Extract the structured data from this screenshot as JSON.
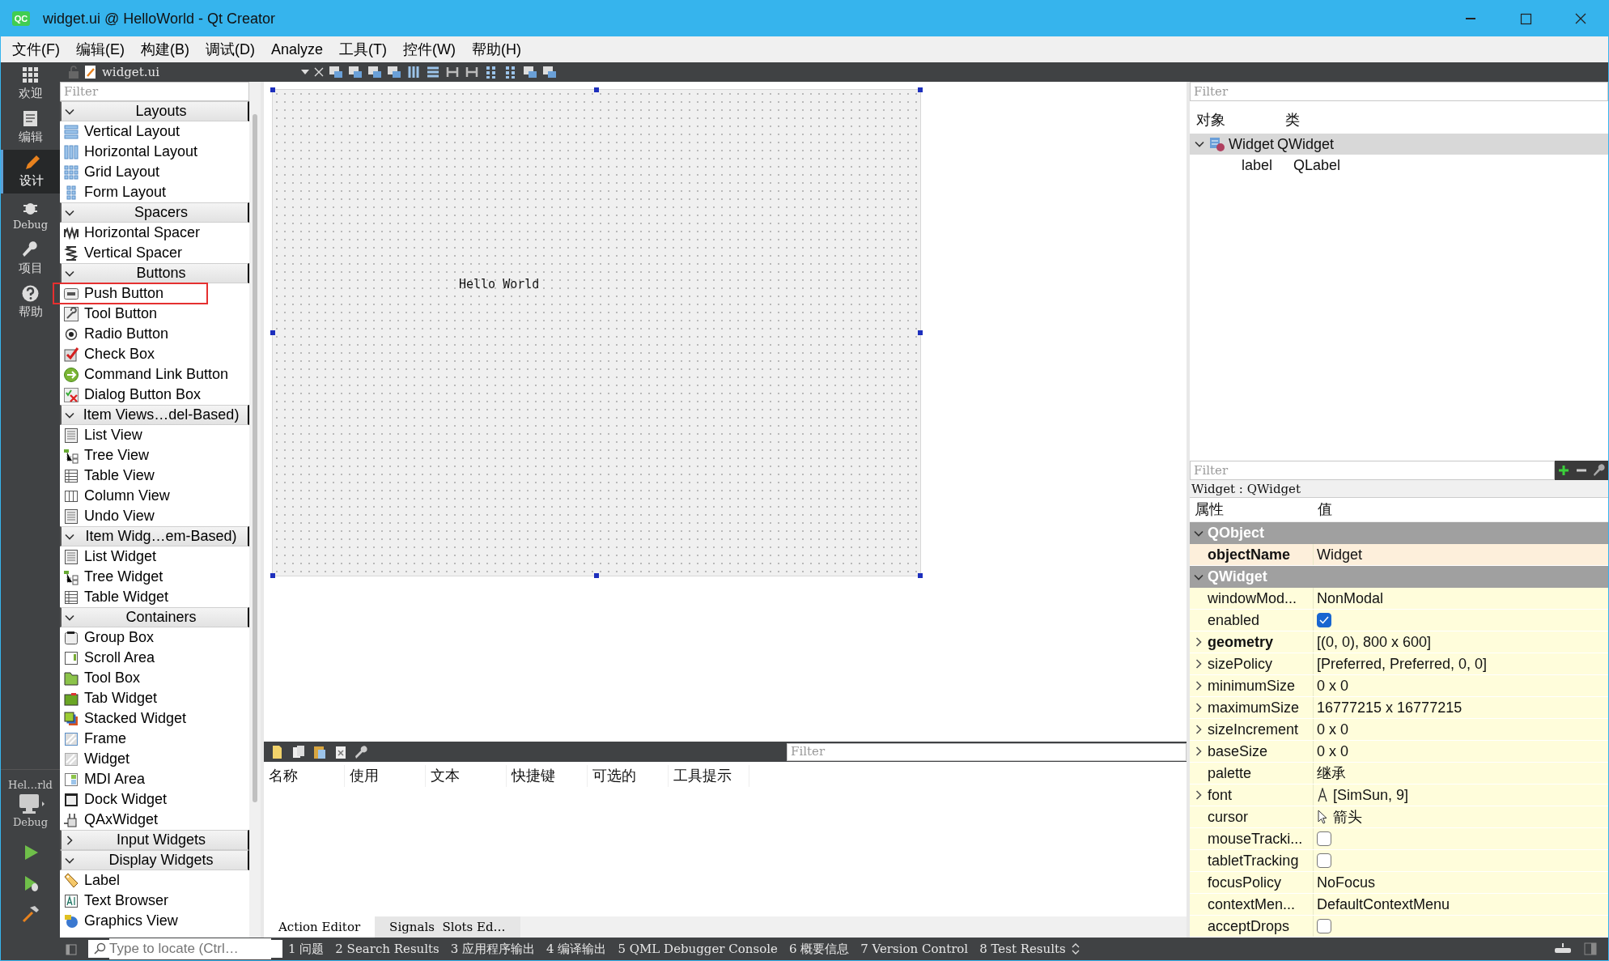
{
  "window": {
    "logo_text": "QC",
    "title": "widget.ui @ HelloWorld - Qt Creator"
  },
  "menu": [
    "文件(F)",
    "编辑(E)",
    "构建(B)",
    "调试(D)",
    "Analyze",
    "工具(T)",
    "控件(W)",
    "帮助(H)"
  ],
  "mode_bar": {
    "items": [
      {
        "label": "欢迎",
        "selected": false
      },
      {
        "label": "编辑",
        "selected": false
      },
      {
        "label": "设计",
        "selected": true
      },
      {
        "label": "Debug",
        "selected": false
      },
      {
        "label": "项目",
        "selected": false
      },
      {
        "label": "帮助",
        "selected": false
      }
    ],
    "target": {
      "project": "Hel…rld",
      "config": "Debug"
    }
  },
  "editor_toolbar": {
    "file": "widget.ui"
  },
  "widget_box": {
    "placeholder": "Filter",
    "categories": [
      {
        "name": "Layouts",
        "expanded": true,
        "items": [
          {
            "label": "Vertical Layout",
            "highlighted": false
          },
          {
            "label": "Horizontal Layout",
            "highlighted": false
          },
          {
            "label": "Grid Layout",
            "highlighted": false
          },
          {
            "label": "Form Layout",
            "highlighted": false
          }
        ]
      },
      {
        "name": "Spacers",
        "expanded": true,
        "items": [
          {
            "label": "Horizontal Spacer",
            "highlighted": false
          },
          {
            "label": "Vertical Spacer",
            "highlighted": false
          }
        ]
      },
      {
        "name": "Buttons",
        "expanded": true,
        "items": [
          {
            "label": "Push Button",
            "highlighted": true
          },
          {
            "label": "Tool Button",
            "highlighted": false
          },
          {
            "label": "Radio Button",
            "highlighted": false
          },
          {
            "label": "Check Box",
            "highlighted": false
          },
          {
            "label": "Command Link Button",
            "highlighted": false
          },
          {
            "label": "Dialog Button Box",
            "highlighted": false
          }
        ]
      },
      {
        "name": "Item Views…del-Based)",
        "expanded": true,
        "items": [
          {
            "label": "List View",
            "highlighted": false
          },
          {
            "label": "Tree View",
            "highlighted": false
          },
          {
            "label": "Table View",
            "highlighted": false
          },
          {
            "label": "Column View",
            "highlighted": false
          },
          {
            "label": "Undo View",
            "highlighted": false
          }
        ]
      },
      {
        "name": "Item Widg…em-Based)",
        "expanded": true,
        "items": [
          {
            "label": "List Widget",
            "highlighted": false
          },
          {
            "label": "Tree Widget",
            "highlighted": false
          },
          {
            "label": "Table Widget",
            "highlighted": false
          }
        ]
      },
      {
        "name": "Containers",
        "expanded": true,
        "items": [
          {
            "label": "Group Box",
            "highlighted": false
          },
          {
            "label": "Scroll Area",
            "highlighted": false
          },
          {
            "label": "Tool Box",
            "highlighted": false
          },
          {
            "label": "Tab Widget",
            "highlighted": false
          },
          {
            "label": "Stacked Widget",
            "highlighted": false
          },
          {
            "label": "Frame",
            "highlighted": false
          },
          {
            "label": "Widget",
            "highlighted": false
          },
          {
            "label": "MDI Area",
            "highlighted": false
          },
          {
            "label": "Dock Widget",
            "highlighted": false
          },
          {
            "label": "QAxWidget",
            "highlighted": false
          }
        ]
      },
      {
        "name": "Input Widgets",
        "expanded": false
      },
      {
        "name": "Display Widgets",
        "expanded": true,
        "items": [
          {
            "label": "Label",
            "highlighted": false
          },
          {
            "label": "Text Browser",
            "highlighted": false
          },
          {
            "label": "Graphics View",
            "highlighted": false
          }
        ]
      }
    ]
  },
  "form": {
    "label_text": "Hello World"
  },
  "action_editor": {
    "placeholder": "Filter",
    "columns": [
      "名称",
      "使用",
      "文本",
      "快捷键",
      "可选的",
      "工具提示"
    ],
    "tabs": [
      {
        "label": "Action Editor",
        "selected": true
      },
      {
        "label": "Signals  Slots Ed…",
        "selected": false
      }
    ]
  },
  "object_inspector": {
    "placeholder": "Filter",
    "columns": [
      "对象",
      "类"
    ],
    "tree": [
      {
        "object": "Widget",
        "class": "QWidget",
        "expanded": true,
        "selected": true,
        "children": [
          {
            "object": "label",
            "class": "QLabel",
            "selected": false
          }
        ]
      }
    ]
  },
  "property_editor": {
    "placeholder": "Filter",
    "title": "Widget : QWidget",
    "columns": [
      "属性",
      "值"
    ],
    "groups": [
      {
        "name": "QObject",
        "expanded": true,
        "properties": [
          {
            "name": "objectName",
            "kind": "text",
            "value": "Widget",
            "modified": true,
            "expandable": false
          }
        ]
      },
      {
        "name": "QWidget",
        "expanded": true,
        "properties": [
          {
            "name": "windowMod...",
            "kind": "text",
            "value": "NonModal",
            "modified": false,
            "expandable": false
          },
          {
            "name": "enabled",
            "kind": "checkbox",
            "checked": true,
            "modified": false,
            "expandable": false
          },
          {
            "name": "geometry",
            "kind": "text",
            "value": "[(0, 0), 800 x 600]",
            "modified": true,
            "expandable": true
          },
          {
            "name": "sizePolicy",
            "kind": "text",
            "value": "[Preferred, Preferred, 0, 0]",
            "modified": false,
            "expandable": true
          },
          {
            "name": "minimumSize",
            "kind": "text",
            "value": "0 x 0",
            "modified": false,
            "expandable": true
          },
          {
            "name": "maximumSize",
            "kind": "text",
            "value": "16777215 x 16777215",
            "modified": false,
            "expandable": true
          },
          {
            "name": "sizeIncrement",
            "kind": "text",
            "value": "0 x 0",
            "modified": false,
            "expandable": true
          },
          {
            "name": "baseSize",
            "kind": "text",
            "value": "0 x 0",
            "modified": false,
            "expandable": true
          },
          {
            "name": "palette",
            "kind": "text",
            "value": "继承",
            "modified": false,
            "expandable": false
          },
          {
            "name": "font",
            "kind": "font",
            "value": "[SimSun, 9]",
            "modified": false,
            "expandable": true
          },
          {
            "name": "cursor",
            "kind": "cursor",
            "value": "箭头",
            "modified": false,
            "expandable": false
          },
          {
            "name": "mouseTracki...",
            "kind": "checkbox",
            "checked": false,
            "modified": false,
            "expandable": false
          },
          {
            "name": "tabletTracking",
            "kind": "checkbox",
            "checked": false,
            "modified": false,
            "expandable": false
          },
          {
            "name": "focusPolicy",
            "kind": "text",
            "value": "NoFocus",
            "modified": false,
            "expandable": false
          },
          {
            "name": "contextMen...",
            "kind": "text",
            "value": "DefaultContextMenu",
            "modified": false,
            "expandable": false
          },
          {
            "name": "acceptDrops",
            "kind": "checkbox",
            "checked": false,
            "modified": false,
            "expandable": false
          }
        ]
      }
    ]
  },
  "status_bar": {
    "locator_placeholder": "Type to locate (Ctrl…",
    "panes": [
      "1 问题",
      "2 Search Results",
      "3 应用程序输出",
      "4 编译输出",
      "5 QML Debugger Console",
      "6 概要信息",
      "7 Version Control",
      "8 Test Results"
    ]
  }
}
